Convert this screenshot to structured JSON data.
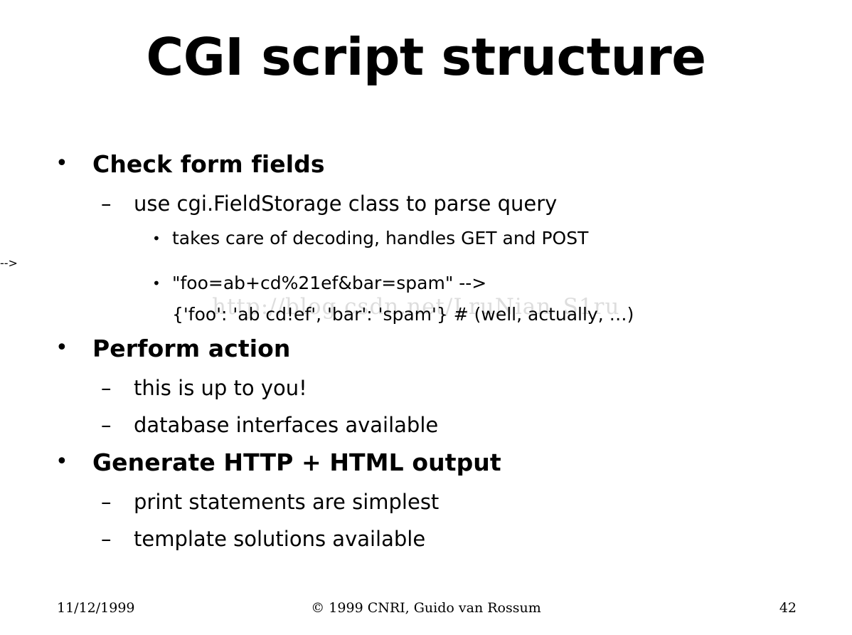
{
  "slide": {
    "title": "CGI script structure",
    "background_color": "#ffffff",
    "text_color": "#000000",
    "bullets": [
      {
        "level": 1,
        "marker": "•",
        "text": "Check form fields"
      },
      {
        "level": 2,
        "marker": "–",
        "text": "use cgi.FieldStorage class to parse query"
      },
      {
        "level": 3,
        "marker": "•",
        "text": "takes care of decoding, handles GET and POST"
      },
      {
        "level": 3,
        "marker": "•",
        "text": "\"foo=ab+cd%21ef&bar=spam\" -->"
      },
      {
        "level": 3,
        "marker": "",
        "continuation": true,
        "text": "{'foo': 'ab cd!ef', 'bar': 'spam'} # (well, actually, …)"
      },
      {
        "level": 1,
        "marker": "•",
        "text": "Perform action"
      },
      {
        "level": 2,
        "marker": "–",
        "text": "this is up to you!"
      },
      {
        "level": 2,
        "marker": "–",
        "text": "database interfaces available"
      },
      {
        "level": 1,
        "marker": "•",
        "text": "Generate HTTP + HTML output"
      },
      {
        "level": 2,
        "marker": "–",
        "text": "print statements are simplest"
      },
      {
        "level": 2,
        "marker": "–",
        "text": "template solutions available"
      }
    ]
  },
  "watermark": {
    "text": "http://blog.csdn.net/LruNian_S1ru",
    "color": "#000000"
  },
  "footer": {
    "date": "11/12/1999",
    "copyright": "© 1999 CNRI, Guido van Rossum",
    "page_number": "42"
  }
}
